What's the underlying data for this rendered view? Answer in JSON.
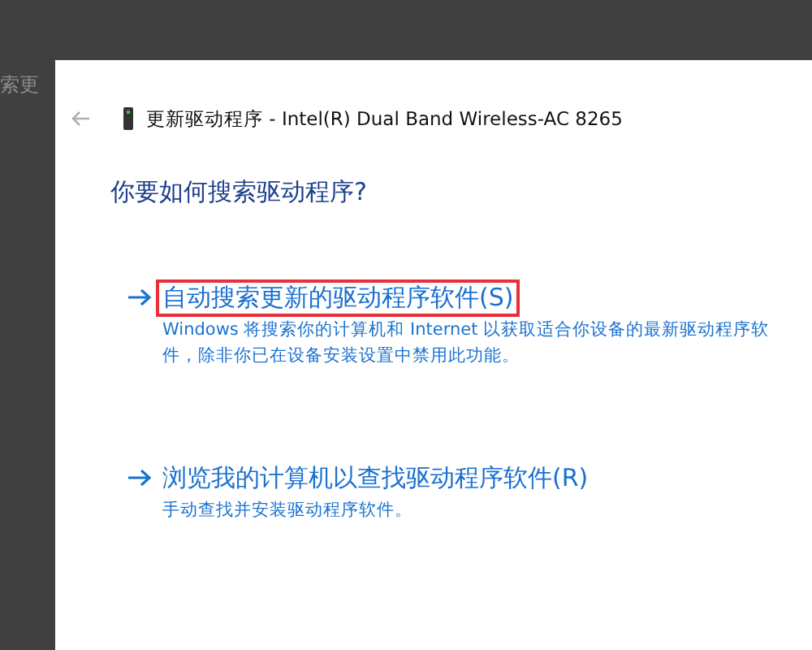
{
  "background_text": "索更",
  "window": {
    "title": "更新驱动程序 - Intel(R) Dual Band Wireless-AC 8265"
  },
  "heading": "你要如何搜索驱动程序?",
  "options": [
    {
      "title": "自动搜索更新的驱动程序软件(S)",
      "description": "Windows 将搜索你的计算机和 Internet 以获取适合你设备的最新驱动程序软件，除非你已在设备安装设置中禁用此功能。",
      "highlighted": true
    },
    {
      "title": "浏览我的计算机以查找驱动程序软件(R)",
      "description": "手动查找并安装驱动程序软件。",
      "highlighted": false
    }
  ]
}
